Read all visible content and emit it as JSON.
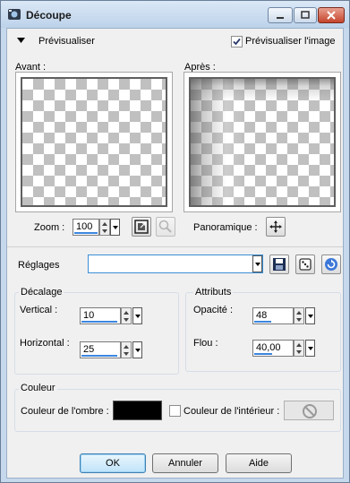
{
  "window": {
    "title": "Découpe"
  },
  "preview": {
    "toggle_label": "Prévisualiser",
    "preview_image_label": "Prévisualiser l'image",
    "preview_image_checked": true,
    "before_label": "Avant :",
    "after_label": "Après :"
  },
  "zoom": {
    "label": "Zoom :",
    "value": "100"
  },
  "pan": {
    "label": "Panoramique :"
  },
  "presets": {
    "label": "Réglages",
    "value": ""
  },
  "offset": {
    "title": "Décalage",
    "vertical_label": "Vertical :",
    "vertical_value": "10",
    "horizontal_label": "Horizontal :",
    "horizontal_value": "25"
  },
  "attributes": {
    "title": "Attributs",
    "opacity_label": "Opacité :",
    "opacity_value": "48",
    "blur_label": "Flou :",
    "blur_value": "40,00"
  },
  "color": {
    "title": "Couleur",
    "shadow_label": "Couleur de l'ombre :",
    "shadow_color": "#000000",
    "inner_label": "Couleur de l'intérieur :",
    "inner_checked": false
  },
  "buttons": {
    "ok": "OK",
    "cancel": "Annuler",
    "help": "Aide"
  }
}
